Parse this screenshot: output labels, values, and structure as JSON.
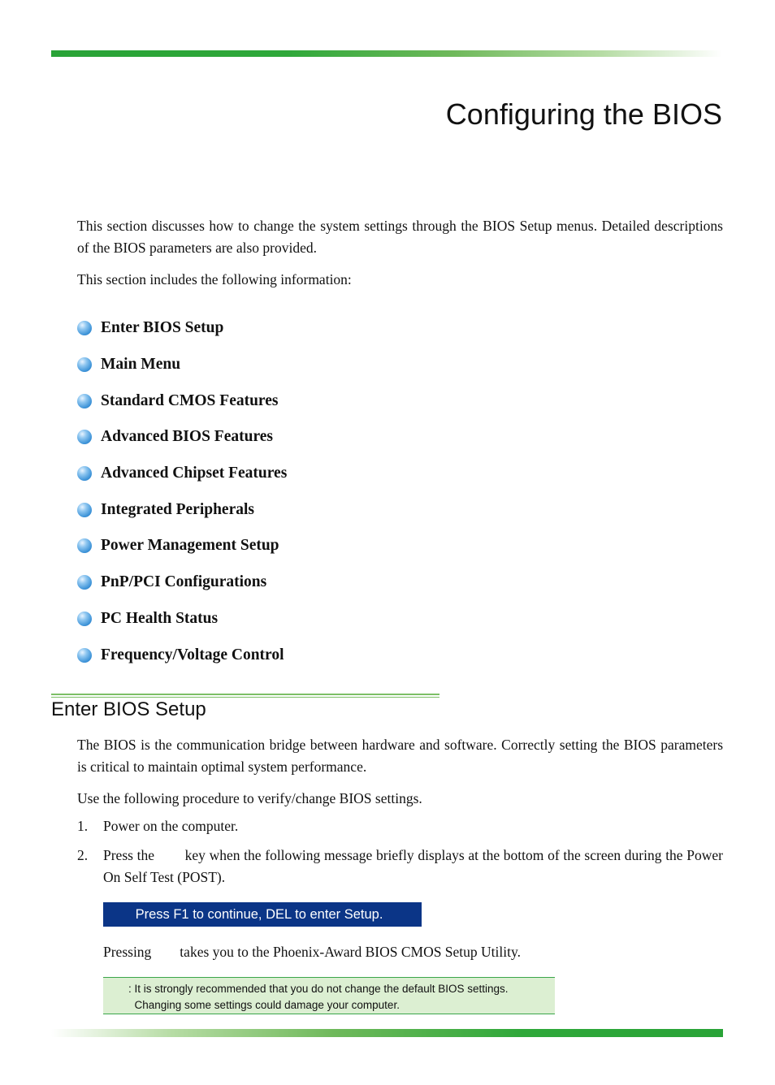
{
  "colors": {
    "accent_green": "#29a337",
    "rule_green": "#7cbf66",
    "post_bg": "#0b3587",
    "note_bg": "#dcefd2",
    "bullet_blue": "#3d93d8"
  },
  "page": {
    "title": "Configuring the BIOS"
  },
  "intro": {
    "paragraph": "This section discusses how to change the system settings through the BIOS Setup menus. Detailed descriptions of the BIOS parameters are also provided.",
    "includes": "This section includes the following information:"
  },
  "toc": {
    "bullet_icon": "blue-sphere-bullet",
    "items": [
      {
        "label": "Enter BIOS Setup"
      },
      {
        "label": "Main Menu"
      },
      {
        "label": "Standard CMOS Features"
      },
      {
        "label": "Advanced BIOS Features"
      },
      {
        "label": "Advanced Chipset Features"
      },
      {
        "label": "Integrated Peripherals"
      },
      {
        "label": "Power Management Setup"
      },
      {
        "label": "PnP/PCI Configurations"
      },
      {
        "label": "PC Health Status"
      },
      {
        "label": "Frequency/Voltage Control"
      }
    ]
  },
  "section": {
    "heading": "Enter BIOS Setup",
    "paragraph": "The BIOS is the communication bridge between hardware and software. Correctly setting the BIOS parameters is critical to maintain optimal system performance.",
    "procedure_intro": "Use the following procedure to verify/change BIOS settings.",
    "steps": [
      {
        "number": "1.",
        "text": "Power on the computer."
      },
      {
        "number": "2.",
        "text": "Press the        key when the following message briefly displays at the bottom of the screen during the Power On Self Test (POST)."
      }
    ],
    "post_message": "Press F1 to continue, DEL to enter Setup.",
    "pressing_text": "Pressing        takes you to the Phoenix-Award BIOS CMOS Setup Utility.",
    "note_line1": ": It is strongly recommended that you do not change the default BIOS settings.",
    "note_line2": "  Changing some settings could damage your computer."
  }
}
